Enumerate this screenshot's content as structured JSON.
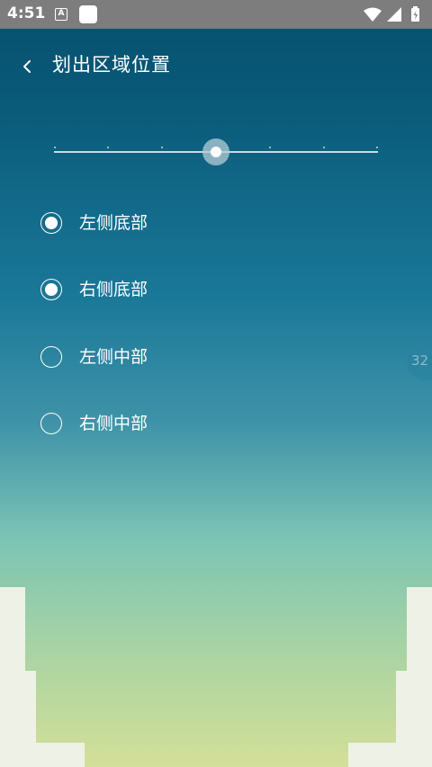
{
  "status_bar": {
    "time": "4:51",
    "notif_letter": "A"
  },
  "header": {
    "title": "划出区域位置"
  },
  "slider": {
    "value": 0.5,
    "tick_count": 7
  },
  "options": [
    {
      "label": "左侧底部",
      "checked": true
    },
    {
      "label": "右侧底部",
      "checked": true
    },
    {
      "label": "左侧中部",
      "checked": false
    },
    {
      "label": "右侧中部",
      "checked": false
    }
  ],
  "edge_bubble": {
    "text": "32"
  },
  "colors": {
    "accent": "#05506e",
    "status_bar": "#7d7d7d"
  }
}
